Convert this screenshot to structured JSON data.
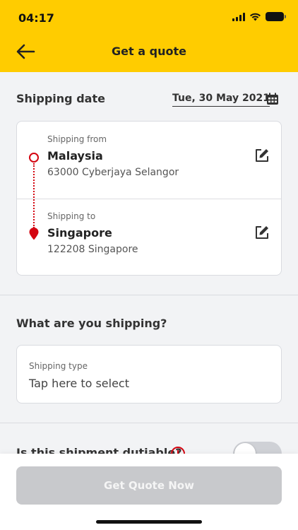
{
  "status_bar": {
    "time": "04:17"
  },
  "header": {
    "title": "Get a quote"
  },
  "shipping_date": {
    "label": "Shipping date",
    "value": "Tue, 30 May 2021"
  },
  "route": {
    "from": {
      "label": "Shipping from",
      "country": "Malaysia",
      "address": "63000 Cyberjaya Selangor"
    },
    "to": {
      "label": "Shipping to",
      "country": "Singapore",
      "address": "122208 Singapore"
    }
  },
  "shipment": {
    "heading": "What are you shipping?",
    "type_label": "Shipping type",
    "type_placeholder": "Tap here to select"
  },
  "dutiable": {
    "label": "Is this shipment dutiable?",
    "enabled": false
  },
  "footer": {
    "button_label": "Get Quote Now"
  },
  "colors": {
    "brand_yellow": "#ffcc00",
    "brand_red": "#d40511",
    "disabled_button": "#c8c9cc"
  },
  "icons": [
    "back-arrow-icon",
    "calendar-icon",
    "edit-icon",
    "origin-dot-icon",
    "location-pin-icon",
    "info-icon"
  ]
}
